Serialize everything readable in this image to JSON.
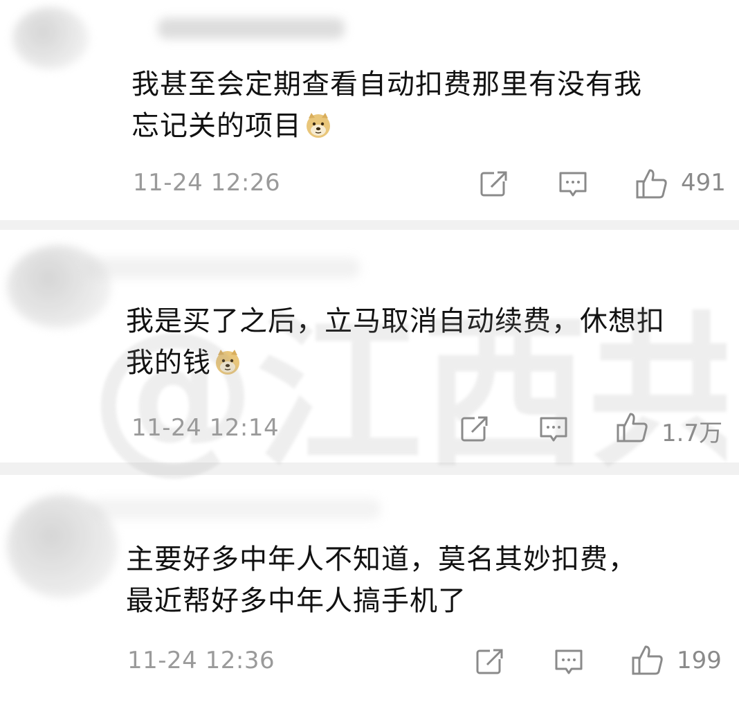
{
  "comments": [
    {
      "lines": [
        "我甚至会定期查看自动扣费那里有没有我",
        "忘记关的项目"
      ],
      "timestamp": "11-24 12:26",
      "likes": "491",
      "emoji": "doge-emoji"
    },
    {
      "lines": [
        "我是买了之后，立马取消自动续费，休想扣",
        "我的钱"
      ],
      "timestamp": "11-24 12:14",
      "likes": "1.7万",
      "emoji": "doge-emoji"
    },
    {
      "lines": [
        "主要好多中年人不知道，莫名其妙扣费，",
        "最近帮好多中年人搞手机了"
      ],
      "timestamp": "11-24 12:36",
      "likes": "199"
    }
  ],
  "watermark": "@江西共青团",
  "colors": {
    "text": "#111111",
    "meta": "#9a9a9a",
    "icon": "#8a8a8a",
    "separator": "#f1f1f1"
  },
  "icons": [
    "share-icon",
    "comment-icon",
    "thumbs-up-icon"
  ]
}
